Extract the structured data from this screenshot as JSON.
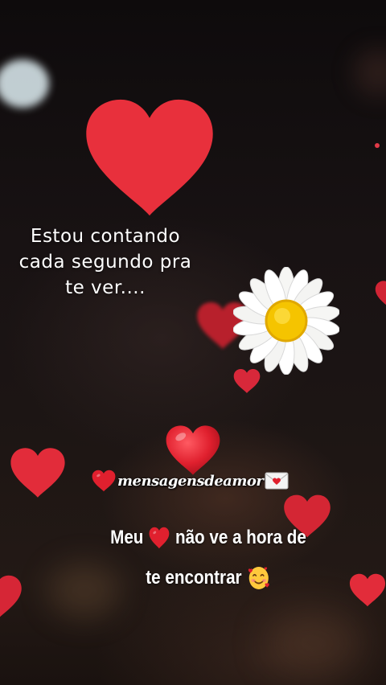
{
  "message": {
    "line1": "Estou contando",
    "line2": "cada segundo pra",
    "line3": "te ver...."
  },
  "watermark": {
    "text": "mensagensdeamor",
    "leading_icon": "red-heart-icon",
    "trailing_icon": "love-letter-icon"
  },
  "caption": {
    "line1_before": "Meu",
    "line1_icon": "red-heart-icon",
    "line1_after": "não ve a hora de",
    "line2": "te encontrar",
    "line2_icon": "smiling-face-with-hearts-icon"
  },
  "decorations": {
    "flower": "daisy",
    "heart_color": "#e8303c"
  }
}
